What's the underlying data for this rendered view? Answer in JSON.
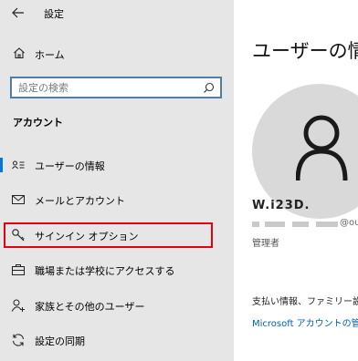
{
  "window": {
    "title": "設定",
    "back_icon": "arrow-left-icon"
  },
  "sidebar": {
    "home": {
      "label": "ホーム",
      "icon": "home-icon"
    },
    "search": {
      "placeholder": "設定の検索",
      "value": "",
      "icon": "search-icon"
    },
    "section_title": "アカウント",
    "items": [
      {
        "label": "ユーザーの情報",
        "icon": "person-card-icon",
        "active": true
      },
      {
        "label": "メールとアカウント",
        "icon": "mail-icon"
      },
      {
        "label": "サインイン オプション",
        "icon": "key-icon",
        "highlighted": true
      },
      {
        "label": "職場または学校にアクセスする",
        "icon": "briefcase-icon"
      },
      {
        "label": "家族とその他のユーザー",
        "icon": "person-add-icon"
      },
      {
        "label": "設定の同期",
        "icon": "sync-icon"
      }
    ]
  },
  "main": {
    "heading": "ユーザーの情報",
    "avatar_icon": "user-avatar-icon",
    "user_name": "W.i23D.",
    "email_suffix": "@outl",
    "role": "管理者",
    "payment_text": "支払い情報、ファミリー設定",
    "ms_account_link": "Microsoft アカウントの管理"
  },
  "colors": {
    "sidebar_bg": "#e6e6e6",
    "accent": "#0078d7",
    "highlight_box": "#e60012",
    "link": "#0063b1",
    "avatar_bg": "#d9d9d9"
  }
}
